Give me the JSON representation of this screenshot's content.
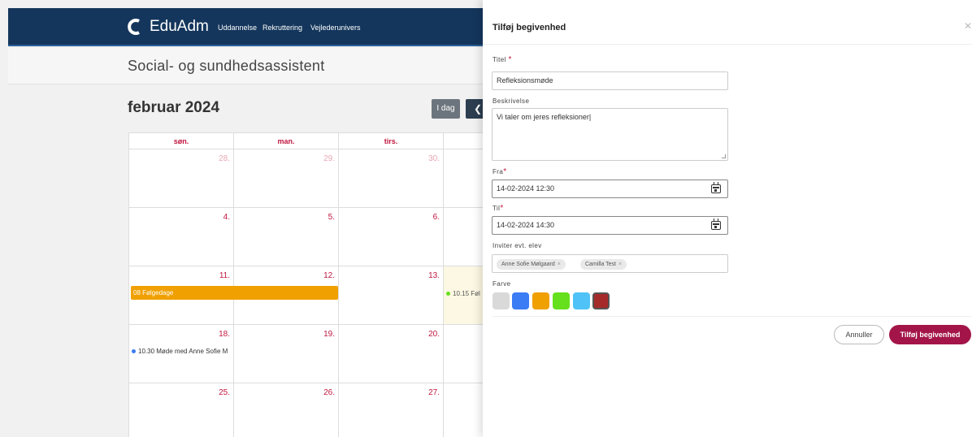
{
  "app": {
    "logo_text": "EduAdm",
    "nav": [
      "Uddannelse",
      "Rekruttering",
      "Vejlederunivers"
    ],
    "page_title": "Social- og sundhedsassistent"
  },
  "calendar": {
    "month_title": "februar 2024",
    "today_label": "I dag",
    "prev_icon": "chevron-left-icon",
    "weekdays": [
      "søn.",
      "man.",
      "tirs."
    ],
    "weeks": [
      [
        "28.",
        "29.",
        "30."
      ],
      [
        "4.",
        "5.",
        "6."
      ],
      [
        "11.",
        "12.",
        "13."
      ],
      [
        "18.",
        "19.",
        "20."
      ],
      [
        "25.",
        "26.",
        "27."
      ]
    ],
    "events": {
      "folgedage": "08 Følgedage",
      "event_13": "10.15 Føl",
      "event_18": "10.30 Møde med Anne Sofie M"
    }
  },
  "panel": {
    "title": "Tilføj begivenhed",
    "close_icon": "close-icon",
    "title_label": "Titel",
    "title_value": "Refleksionsmøde",
    "desc_label": "Beskrivelse",
    "desc_value": "Vi taler om jeres refleksioner",
    "from_label": "Fra",
    "from_value": "14-02-2024 12:30",
    "to_label": "Til",
    "to_value": "14-02-2024 14:30",
    "invite_label": "Inviter evt. elev",
    "invitees": [
      "Anne Sofie Mølgaard",
      "Camilla Test"
    ],
    "color_label": "Farve",
    "colors": [
      "#d9d9d9",
      "#3b7cf5",
      "#f0a000",
      "#66e01c",
      "#4fc3f7",
      "#a52a2a"
    ],
    "selected_color": "#a52a2a",
    "cancel_label": "Annuller",
    "submit_label": "Tilføj begivenhed"
  }
}
